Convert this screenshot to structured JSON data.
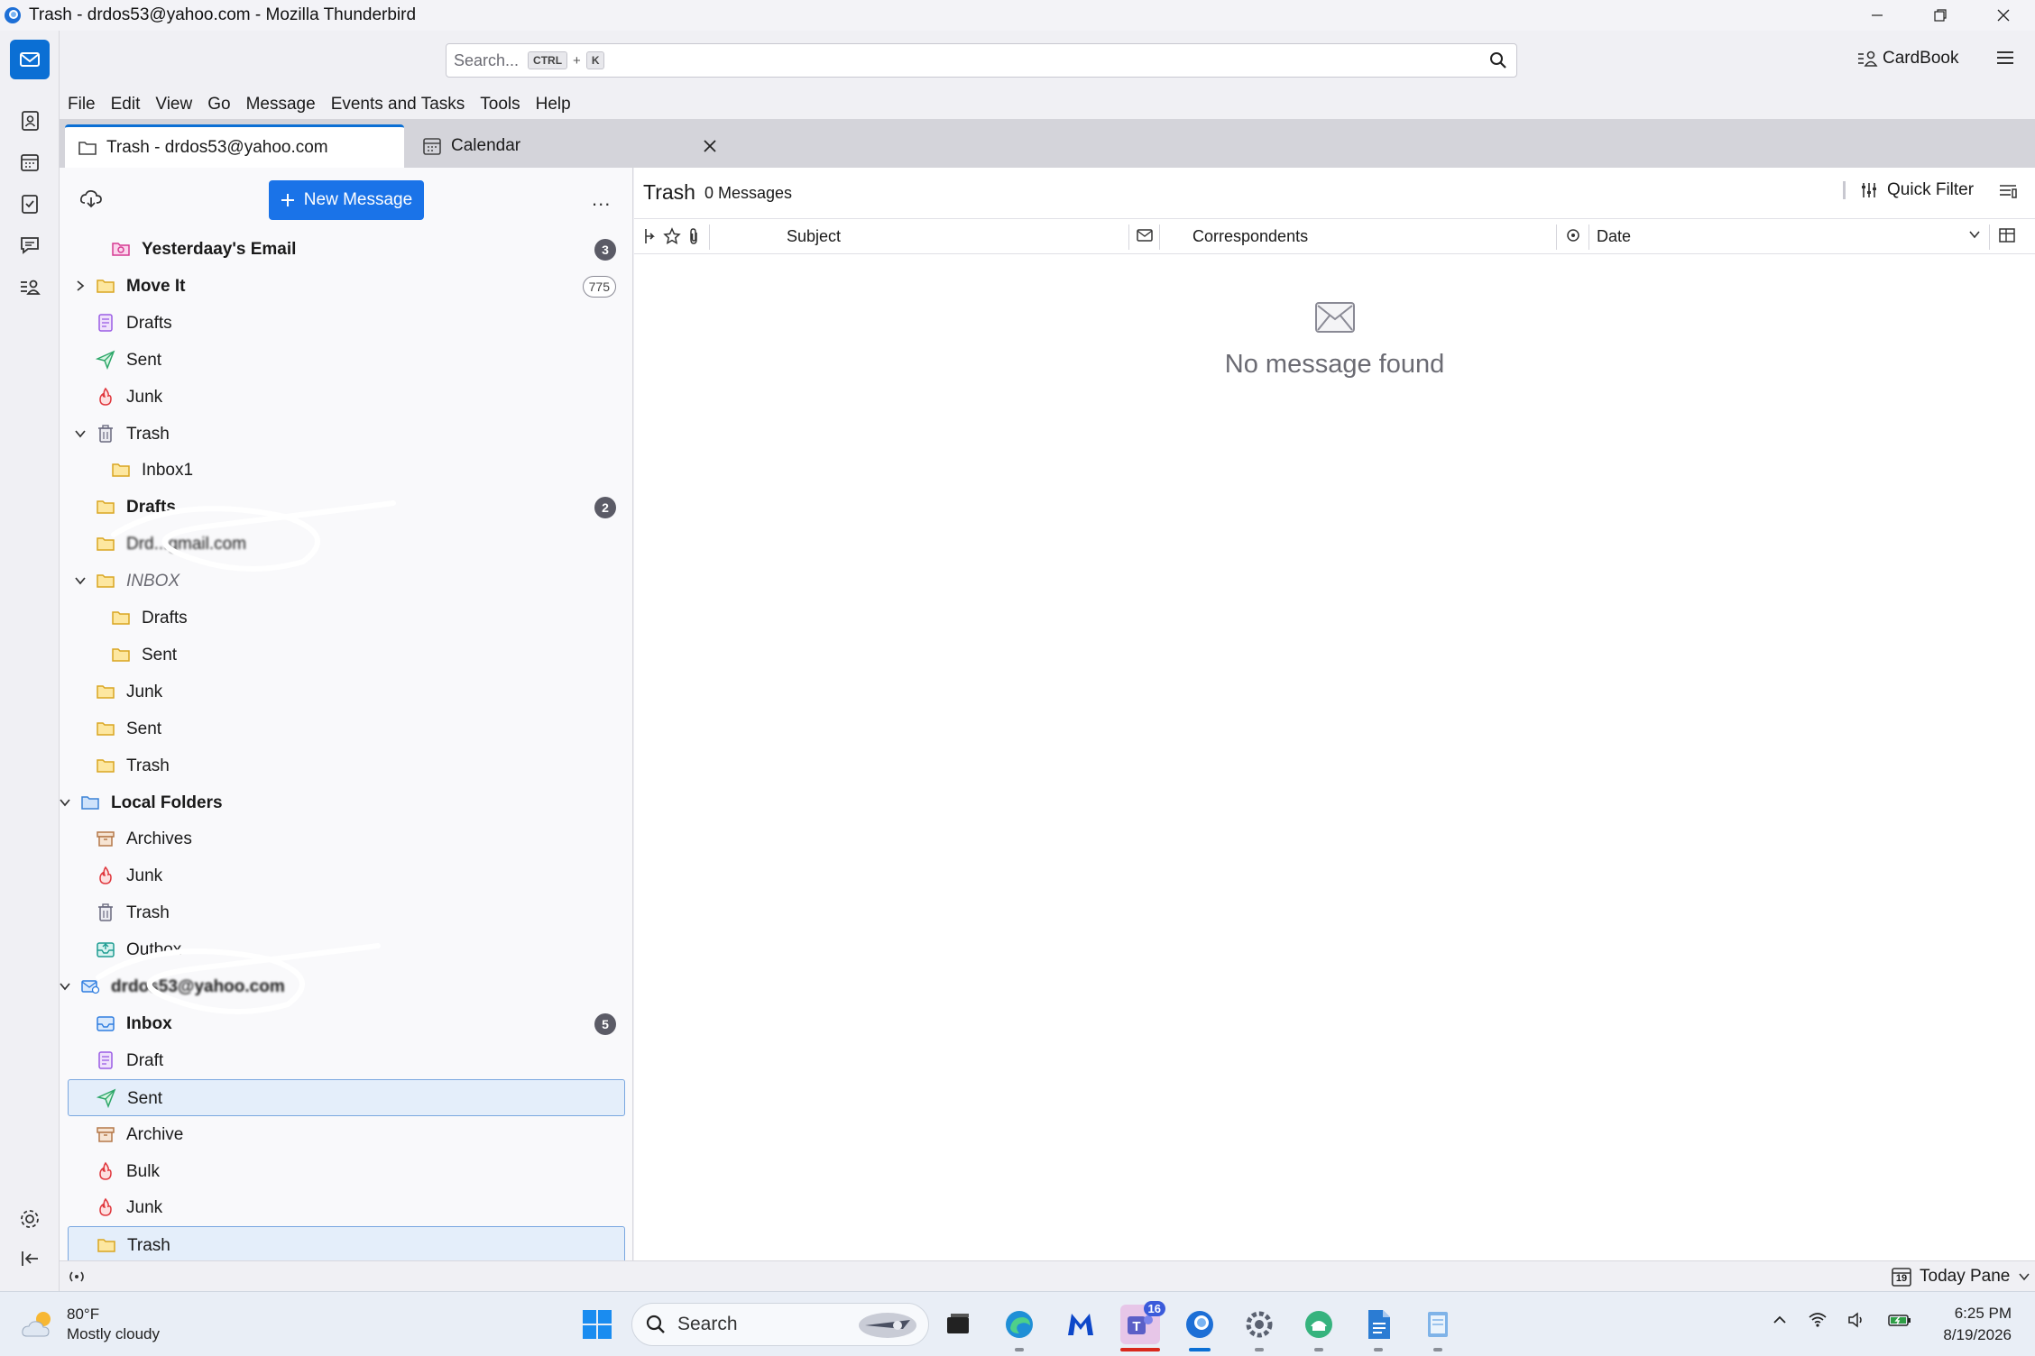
{
  "window": {
    "title": "Trash - drdos53@yahoo.com - Mozilla Thunderbird"
  },
  "toolbar": {
    "search_placeholder": "Search...",
    "search_key_ctrl": "CTRL",
    "search_key_plus": "+",
    "search_key_k": "K",
    "cardbook_label": "CardBook"
  },
  "menu": [
    "File",
    "Edit",
    "View",
    "Go",
    "Message",
    "Events and Tasks",
    "Tools",
    "Help"
  ],
  "tabs": [
    {
      "label": "Trash - drdos53@yahoo.com"
    },
    {
      "label": "Calendar"
    }
  ],
  "folder_pane": {
    "new_message_label": "New Message",
    "more_label": "...",
    "folders": [
      {
        "label": "Yesterdaay's Email",
        "icon": "saved-search-icon",
        "bold": true,
        "badge": "3"
      },
      {
        "label": "Move It",
        "icon": "folder-icon",
        "bold": true,
        "badge": "775",
        "twisty": "collapsed"
      },
      {
        "label": "Drafts",
        "icon": "drafts-icon"
      },
      {
        "label": "Sent",
        "icon": "sent-icon"
      },
      {
        "label": "Junk",
        "icon": "junk-icon"
      },
      {
        "label": "Trash",
        "icon": "trash-icon",
        "twisty": "expanded"
      },
      {
        "label": "Inbox1",
        "icon": "folder-icon"
      },
      {
        "label": "Drafts",
        "icon": "folder-icon",
        "bold": true,
        "badge": "2"
      },
      {
        "label": "Drd...gmail.com",
        "icon": "folder-icon",
        "redacted": true
      },
      {
        "label": "INBOX",
        "icon": "folder-icon",
        "italic": true,
        "twisty": "expanded"
      },
      {
        "label": "Drafts",
        "icon": "folder-icon"
      },
      {
        "label": "Sent",
        "icon": "folder-icon"
      },
      {
        "label": "Junk",
        "icon": "folder-icon"
      },
      {
        "label": "Sent",
        "icon": "folder-icon"
      },
      {
        "label": "Trash",
        "icon": "folder-icon"
      },
      {
        "label": "Local Folders",
        "icon": "local-folder-icon",
        "bold": true,
        "twisty": "expanded"
      },
      {
        "label": "Archives",
        "icon": "archive-icon"
      },
      {
        "label": "Junk",
        "icon": "junk-icon"
      },
      {
        "label": "Trash",
        "icon": "trash-icon"
      },
      {
        "label": "Outbox",
        "icon": "outbox-icon"
      },
      {
        "label": "drdos53@yahoo.com",
        "icon": "account-icon",
        "bold": true,
        "twisty": "expanded",
        "redacted": true
      },
      {
        "label": "Inbox",
        "icon": "inbox-icon",
        "bold": true,
        "badge": "5"
      },
      {
        "label": "Draft",
        "icon": "drafts-icon"
      },
      {
        "label": "Sent",
        "icon": "sent-icon",
        "selected": true
      },
      {
        "label": "Archive",
        "icon": "archive-icon"
      },
      {
        "label": "Bulk",
        "icon": "junk-icon"
      },
      {
        "label": "Junk",
        "icon": "junk-icon"
      },
      {
        "label": "Trash",
        "icon": "folder-icon",
        "selected": true
      }
    ]
  },
  "message_pane": {
    "folder_name": "Trash",
    "message_count": "0 Messages",
    "quick_filter_label": "Quick Filter",
    "columns": {
      "subject": "Subject",
      "correspondents": "Correspondents",
      "date": "Date"
    },
    "empty_text": "No message found"
  },
  "statusbar": {
    "today_pane_label": "Today Pane",
    "today_date_num": "19"
  },
  "taskbar": {
    "weather_temp": "80°F",
    "weather_desc": "Mostly cloudy",
    "search_label": "Search",
    "teams_badge": "16",
    "time": "6:25 PM",
    "date": "8/19/2026"
  },
  "colors": {
    "accent": "#0b6fd4",
    "new_message_bg": "#1a73e8",
    "selection_bg": "#e4eefa"
  }
}
